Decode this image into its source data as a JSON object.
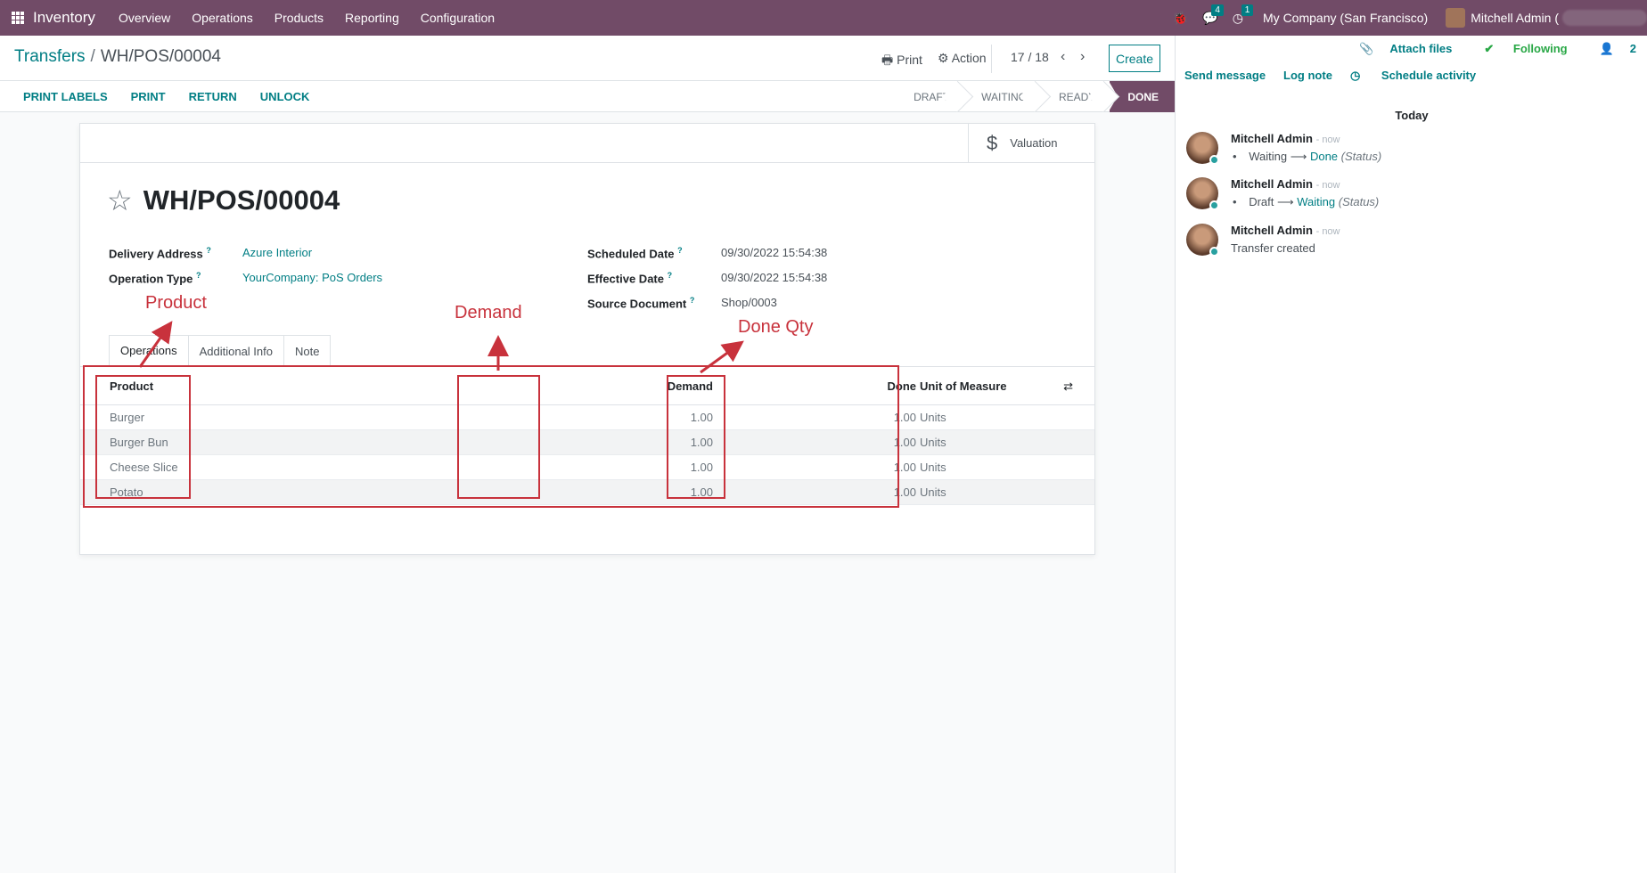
{
  "navbar": {
    "app_name": "Inventory",
    "menu": [
      "Overview",
      "Operations",
      "Products",
      "Reporting",
      "Configuration"
    ],
    "messages_count": "4",
    "activities_count": "1",
    "company": "My Company (San Francisco)",
    "user": "Mitchell Admin ("
  },
  "breadcrumb": {
    "parent": "Transfers",
    "current": "WH/POS/00004"
  },
  "control": {
    "print": "Print",
    "action": "Action",
    "pager": "17 / 18",
    "create": "Create"
  },
  "statusbar": {
    "actions": [
      "PRINT LABELS",
      "PRINT",
      "RETURN",
      "UNLOCK"
    ],
    "stages": [
      "DRAFT",
      "WAITING",
      "READY",
      "DONE"
    ],
    "active_stage": "DONE"
  },
  "form": {
    "valuation": "Valuation",
    "title": "WH/POS/00004",
    "delivery_address_label": "Delivery Address",
    "delivery_address": "Azure Interior",
    "operation_type_label": "Operation Type",
    "operation_type": "YourCompany: PoS Orders",
    "scheduled_date_label": "Scheduled Date",
    "scheduled_date": "09/30/2022 15:54:38",
    "effective_date_label": "Effective Date",
    "effective_date": "09/30/2022 15:54:38",
    "source_document_label": "Source Document",
    "source_document": "Shop/0003",
    "help_mark": "?",
    "tabs": [
      "Operations",
      "Additional Info",
      "Note"
    ]
  },
  "table": {
    "headers": {
      "product": "Product",
      "demand": "Demand",
      "done": "Done",
      "uom": "Unit of Measure"
    },
    "rows": [
      {
        "product": "Burger",
        "demand": "1.00",
        "done": "1.00",
        "uom": "Units"
      },
      {
        "product": "Burger Bun",
        "demand": "1.00",
        "done": "1.00",
        "uom": "Units"
      },
      {
        "product": "Cheese Slice",
        "demand": "1.00",
        "done": "1.00",
        "uom": "Units"
      },
      {
        "product": "Potato",
        "demand": "1.00",
        "done": "1.00",
        "uom": "Units"
      }
    ]
  },
  "annotations": {
    "product": "Product",
    "demand": "Demand",
    "done_qty": "Done Qty",
    "color": "#c8323c"
  },
  "chatter": {
    "attach_files": "Attach files",
    "following": "Following",
    "followers": "2",
    "send_message": "Send message",
    "log_note": "Log note",
    "schedule_activity": "Schedule activity",
    "today": "Today",
    "messages": [
      {
        "author": "Mitchell Admin",
        "time": "- now",
        "old": "Waiting",
        "new": "Done",
        "field": "(Status)"
      },
      {
        "author": "Mitchell Admin",
        "time": "- now",
        "old": "Draft",
        "new": "Waiting",
        "field": "(Status)"
      },
      {
        "author": "Mitchell Admin",
        "time": "- now",
        "text": "Transfer created"
      }
    ]
  },
  "colors": {
    "brand": "#714b67",
    "accent": "#017e84"
  }
}
